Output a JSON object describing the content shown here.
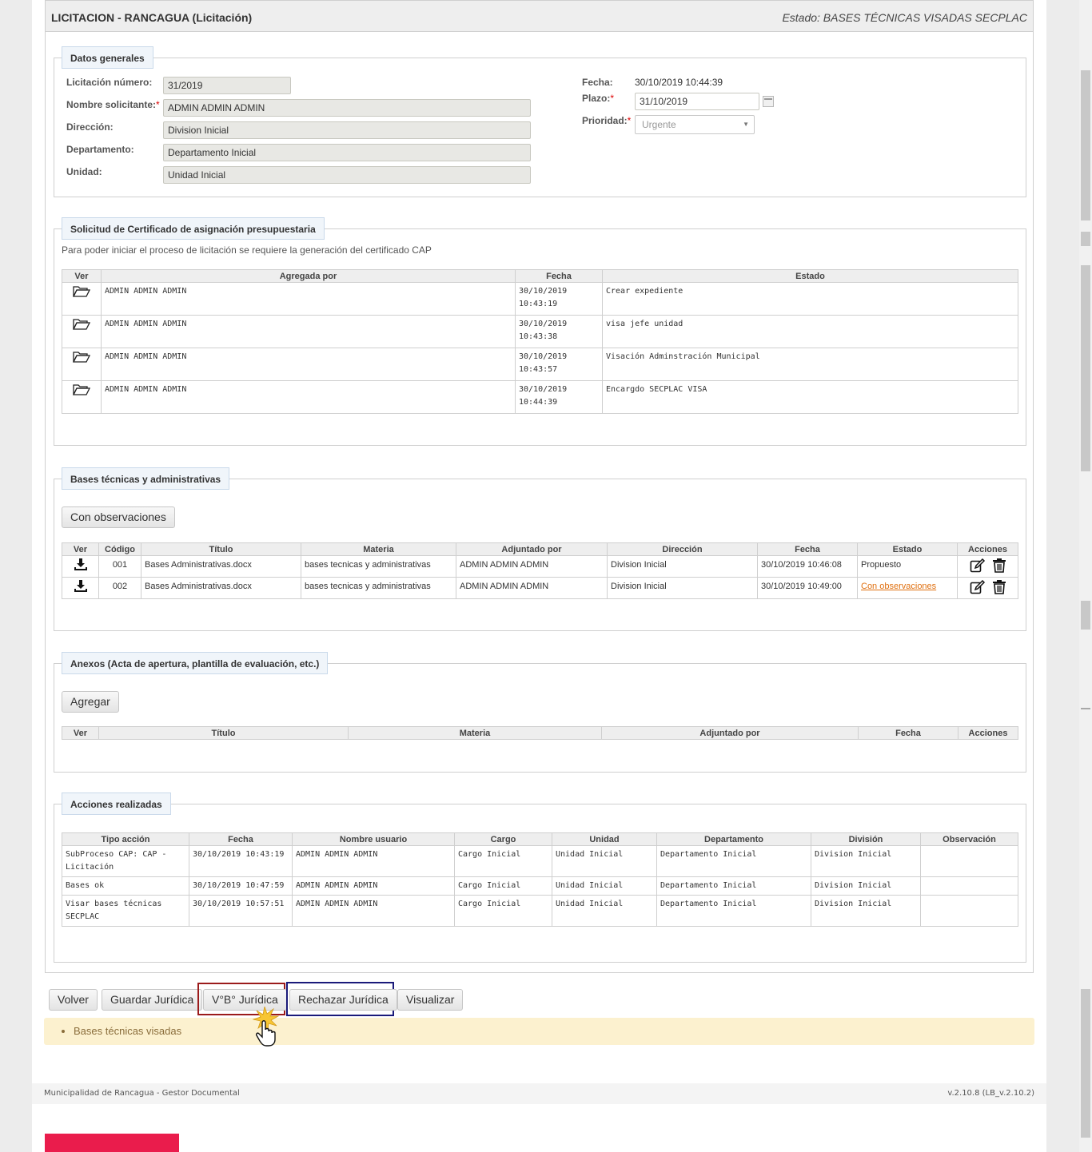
{
  "header": {
    "title": "LICITACION - RANCAGUA (Licitación)",
    "status": "Estado: BASES TÉCNICAS VISADAS SECPLAC"
  },
  "general": {
    "legend": "Datos generales",
    "licitacion_label": "Licitación número:",
    "licitacion_value": "31/2019",
    "solicitante_label": "Nombre solicitante:",
    "solicitante_value": "ADMIN ADMIN ADMIN",
    "direccion_label": "Dirección:",
    "direccion_value": "Division Inicial",
    "departamento_label": "Departamento:",
    "departamento_value": "Departamento Inicial",
    "unidad_label": "Unidad:",
    "unidad_value": "Unidad Inicial",
    "fecha_label": "Fecha:",
    "fecha_value": "30/10/2019 10:44:39",
    "plazo_label": "Plazo:",
    "plazo_value": "31/10/2019",
    "prioridad_label": "Prioridad:",
    "prioridad_value": "Urgente",
    "required_mark": "*"
  },
  "cap": {
    "legend": "Solicitud de Certificado de asignación presupuestaria",
    "description": "Para poder iniciar el proceso de licitación se requiere la generación del certificado CAP",
    "columns": [
      "Ver",
      "Agregada por",
      "Fecha",
      "Estado"
    ],
    "rows": [
      {
        "by": "ADMIN ADMIN ADMIN",
        "date": "30/10/2019",
        "time": "10:43:19",
        "estado": "Crear expediente"
      },
      {
        "by": "ADMIN ADMIN ADMIN",
        "date": "30/10/2019",
        "time": "10:43:38",
        "estado": "visa jefe unidad"
      },
      {
        "by": "ADMIN ADMIN ADMIN",
        "date": "30/10/2019",
        "time": "10:43:57",
        "estado": "Visación Adminstración Municipal"
      },
      {
        "by": "ADMIN ADMIN ADMIN",
        "date": "30/10/2019",
        "time": "10:44:39",
        "estado": "Encargdo SECPLAC VISA"
      }
    ]
  },
  "bases": {
    "legend": "Bases técnicas y administrativas",
    "button": "Con observaciones",
    "columns": [
      "Ver",
      "Código",
      "Título",
      "Materia",
      "Adjuntado por",
      "Dirección",
      "Fecha",
      "Estado",
      "Acciones"
    ],
    "rows": [
      {
        "codigo": "001",
        "titulo": "Bases Administrativas.docx",
        "materia": "bases tecnicas y administrativas",
        "adjuntado": "ADMIN ADMIN ADMIN",
        "direccion": "Division Inicial",
        "fecha": "30/10/2019 10:46:08",
        "estado": "Propuesto"
      },
      {
        "codigo": "002",
        "titulo": "Bases Administrativas.docx",
        "materia": "bases tecnicas y administrativas",
        "adjuntado": "ADMIN ADMIN ADMIN",
        "direccion": "Division Inicial",
        "fecha": "30/10/2019 10:49:00",
        "estado": "Con observaciones"
      }
    ],
    "link_color": "#e07010"
  },
  "anexos": {
    "legend": "Anexos (Acta de apertura, plantilla de evaluación, etc.)",
    "button": "Agregar",
    "columns": [
      "Ver",
      "Título",
      "Materia",
      "Adjuntado por",
      "Fecha",
      "Acciones"
    ]
  },
  "acciones": {
    "legend": "Acciones realizadas",
    "columns": [
      "Tipo acción",
      "Fecha",
      "Nombre usuario",
      "Cargo",
      "Unidad",
      "Departamento",
      "División",
      "Observación"
    ],
    "rows": [
      {
        "tipo": "SubProceso CAP: CAP - Licitación",
        "fecha": "30/10/2019 10:43:19",
        "usuario": "ADMIN ADMIN ADMIN",
        "cargo": "Cargo Inicial",
        "unidad": "Unidad Inicial",
        "departamento": "Departamento Inicial",
        "division": "Division Inicial",
        "observacion": ""
      },
      {
        "tipo": "Bases ok",
        "fecha": "30/10/2019 10:47:59",
        "usuario": "ADMIN ADMIN ADMIN",
        "cargo": "Cargo Inicial",
        "unidad": "Unidad Inicial",
        "departamento": "Departamento Inicial",
        "division": "Division Inicial",
        "observacion": ""
      },
      {
        "tipo": "Visar bases técnicas SECPLAC",
        "fecha": "30/10/2019 10:57:51",
        "usuario": "ADMIN ADMIN ADMIN",
        "cargo": "Cargo Inicial",
        "unidad": "Unidad Inicial",
        "departamento": "Departamento Inicial",
        "division": "Division Inicial",
        "observacion": ""
      }
    ]
  },
  "actions": {
    "volver": "Volver",
    "guardar": "Guardar Jurídica",
    "vb": "V°B° Jurídica",
    "rechazar": "Rechazar Jurídica",
    "visualizar": "Visualizar",
    "vb_highlight_color": "#9b1b1b",
    "rechazar_highlight_color": "#1a1a7a"
  },
  "message": {
    "text": "Bases técnicas visadas"
  },
  "footer": {
    "left": "Municipalidad de Rancagua - Gestor Documental",
    "right": "v.2.10.8 (LB_v.2.10.2)",
    "brand_color": "#ea1c4c"
  },
  "icons": {
    "open": "folder-open-icon",
    "download": "download-icon",
    "edit": "edit-icon",
    "delete": "trash-icon",
    "calendar": "calendar-icon",
    "cursor": "hand-cursor-icon"
  }
}
